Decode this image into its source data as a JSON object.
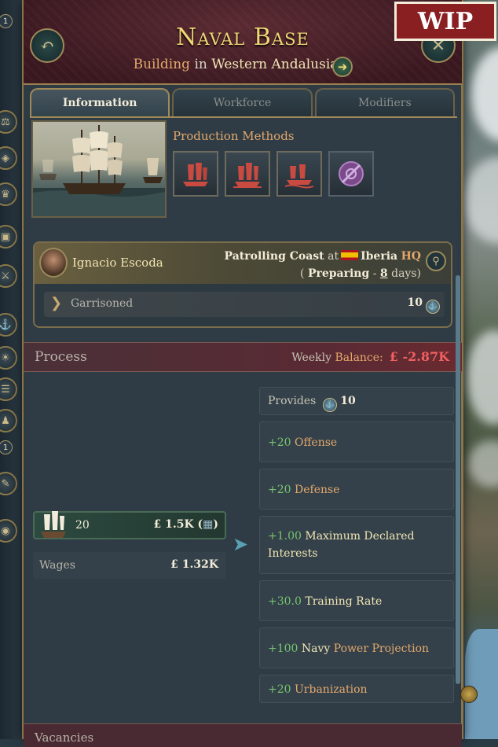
{
  "wip_label": "WIP",
  "header": {
    "title": "Naval Base",
    "sub_prefix": "Building",
    "sub_in": "in",
    "location": "Western Andalusia"
  },
  "tabs": [
    {
      "label": "Information",
      "active": true
    },
    {
      "label": "Workforce"
    },
    {
      "label": "Modifiers"
    }
  ],
  "production_methods": {
    "title": "Production Methods",
    "icons": [
      "ship-of-the-line-icon",
      "frigate-icon",
      "ironclad-icon",
      "disabled-admiralty-icon"
    ]
  },
  "commander": {
    "name": "Ignacio Escoda",
    "mission": "Patrolling Coast",
    "at": "at",
    "hq": "Iberia",
    "hq_suffix": "HQ",
    "status_open": "(",
    "status": "Preparing",
    "status_sep": "-",
    "days": "8",
    "days_label": "days",
    "status_close": ")",
    "garrison_label": "Garrisoned",
    "garrison_value": "10"
  },
  "process": {
    "label": "Process",
    "balance_label1": "Weekly",
    "balance_label2": "Balance:",
    "balance_value": "£ -2.87K"
  },
  "inputs": {
    "count": "20",
    "cost": "£ 1.5K ("
  },
  "wages": {
    "label": "Wages",
    "value": "£ 1.32K"
  },
  "outputs": {
    "provides_label": "Provides",
    "provides_value": "10",
    "offense_val": "+20",
    "offense_label": "Offense",
    "defense_val": "+20",
    "defense_label": "Defense",
    "mdi_val": "+1.00",
    "mdi_label1": "Maximum Declared",
    "mdi_label2": "Interests",
    "training_val": "+30.0",
    "training_label": "Training Rate",
    "npp_val": "+100",
    "npp_label1": "Navy",
    "npp_label2": "Power Projection",
    "urban_val": "+20",
    "urban_label": "Urbanization"
  },
  "vacancies_label": "Vacancies",
  "leftbar_badges": [
    "1",
    "1"
  ],
  "colors": {
    "title": "#f0d774",
    "accent": "#e3a86c",
    "positive": "#78c470",
    "negative": "#f06060"
  }
}
